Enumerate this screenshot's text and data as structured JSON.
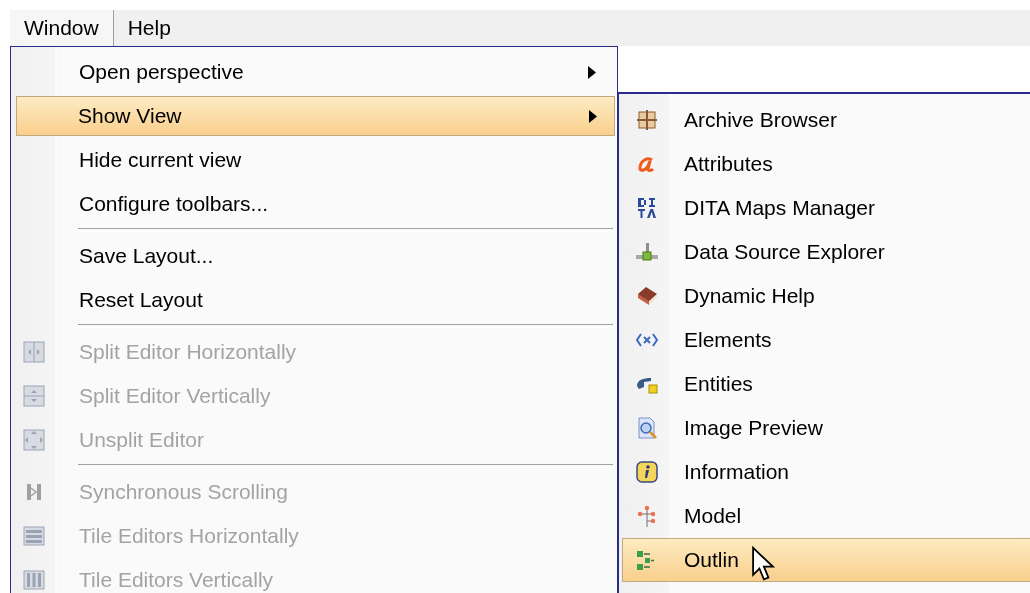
{
  "menubar": [
    {
      "label": "Window",
      "selected": true
    },
    {
      "label": "Help",
      "selected": false
    }
  ],
  "menu": {
    "items": [
      {
        "kind": "item",
        "label": "Open perspective",
        "disabled": false,
        "submenu": true,
        "selected": false
      },
      {
        "kind": "item",
        "label": "Show View",
        "disabled": false,
        "submenu": true,
        "selected": true
      },
      {
        "kind": "item",
        "label": "Hide current view",
        "disabled": false,
        "submenu": false,
        "selected": false
      },
      {
        "kind": "item",
        "label": "Configure toolbars...",
        "disabled": false,
        "submenu": false,
        "selected": false
      },
      {
        "kind": "separator"
      },
      {
        "kind": "item",
        "label": "Save Layout...",
        "disabled": false,
        "submenu": false,
        "selected": false
      },
      {
        "kind": "item",
        "label": "Reset Layout",
        "disabled": false,
        "submenu": false,
        "selected": false
      },
      {
        "kind": "separator"
      },
      {
        "kind": "item",
        "label": "Split Editor Horizontally",
        "disabled": true,
        "submenu": false,
        "selected": false
      },
      {
        "kind": "item",
        "label": "Split Editor Vertically",
        "disabled": true,
        "submenu": false,
        "selected": false
      },
      {
        "kind": "item",
        "label": "Unsplit Editor",
        "disabled": true,
        "submenu": false,
        "selected": false
      },
      {
        "kind": "separator"
      },
      {
        "kind": "item",
        "label": "Synchronous Scrolling",
        "disabled": true,
        "submenu": false,
        "selected": false
      },
      {
        "kind": "item",
        "label": "Tile Editors Horizontally",
        "disabled": true,
        "submenu": false,
        "selected": false
      },
      {
        "kind": "item",
        "label": "Tile Editors Vertically",
        "disabled": true,
        "submenu": false,
        "selected": false
      }
    ]
  },
  "submenu": {
    "items": [
      {
        "label": "Archive Browser",
        "selected": false
      },
      {
        "label": "Attributes",
        "selected": false
      },
      {
        "label": "DITA Maps Manager",
        "selected": false
      },
      {
        "label": "Data Source Explorer",
        "selected": false
      },
      {
        "label": "Dynamic Help",
        "selected": false
      },
      {
        "label": "Elements",
        "selected": false
      },
      {
        "label": "Entities",
        "selected": false
      },
      {
        "label": "Image Preview",
        "selected": false
      },
      {
        "label": "Information",
        "selected": false
      },
      {
        "label": "Model",
        "selected": false
      },
      {
        "label": "Outlin",
        "selected": true
      }
    ]
  }
}
